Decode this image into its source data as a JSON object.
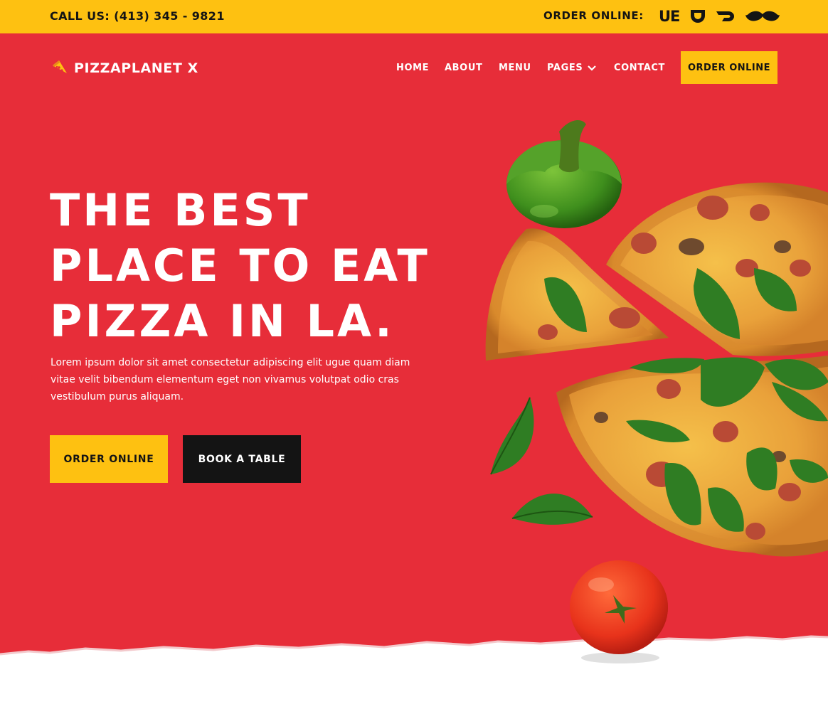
{
  "topbar": {
    "call": "CALL US: (413) 345 - 9821",
    "order_label": "ORDER ONLINE:",
    "services": [
      {
        "icon": "ubereats-icon",
        "text": "UE"
      },
      {
        "icon": "grubhub-icon"
      },
      {
        "icon": "doordash-icon"
      },
      {
        "icon": "postmates-icon"
      }
    ]
  },
  "header": {
    "brand": "PIZZAPLANET X",
    "nav": [
      "HOME",
      "ABOUT",
      "MENU",
      "PAGES",
      "CONTACT"
    ],
    "cta": "ORDER ONLINE"
  },
  "hero": {
    "headline": [
      "THE BEST",
      "PLACE TO EAT",
      "PIZZA IN LA."
    ],
    "description": "Lorem ipsum dolor sit amet consectetur adipiscing elit ugue quam diam vitae velit bibendum elementum eget non vivamus volutpat odio cras vestibulum purus aliquam.",
    "primary_button": "ORDER ONLINE",
    "secondary_button": "BOOK A TABLE"
  },
  "colors": {
    "accent_yellow": "#fec111",
    "hero_red": "#e72d39",
    "dark": "#141414"
  }
}
